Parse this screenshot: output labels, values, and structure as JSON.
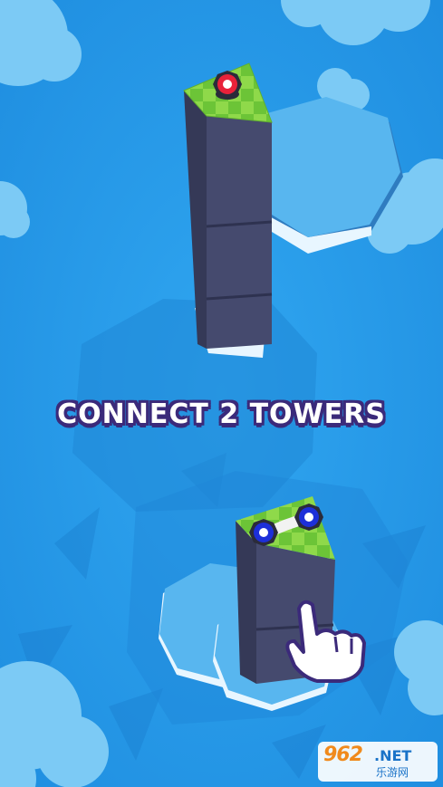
{
  "game": {
    "headline": "CONNECT 2 TOWERS",
    "colors": {
      "water": "#2a9be8",
      "island": "#58b6ef",
      "tower_front": "#454a6e",
      "tower_side": "#353957",
      "grass_light": "#8fd94a",
      "grass_dark": "#6cc437",
      "red_node": "#e8223a",
      "blue_node": "#1d2fd9",
      "headline_outline": "#3b2a7a"
    },
    "top_tower": {
      "node_color": "red"
    },
    "bottom_tower": {
      "node_colors": [
        "blue",
        "blue"
      ]
    },
    "hand_cursor": "hand-pointer-icon"
  },
  "watermark": {
    "brand": "962",
    "suffix": ".NET",
    "subtitle": "乐游网"
  }
}
